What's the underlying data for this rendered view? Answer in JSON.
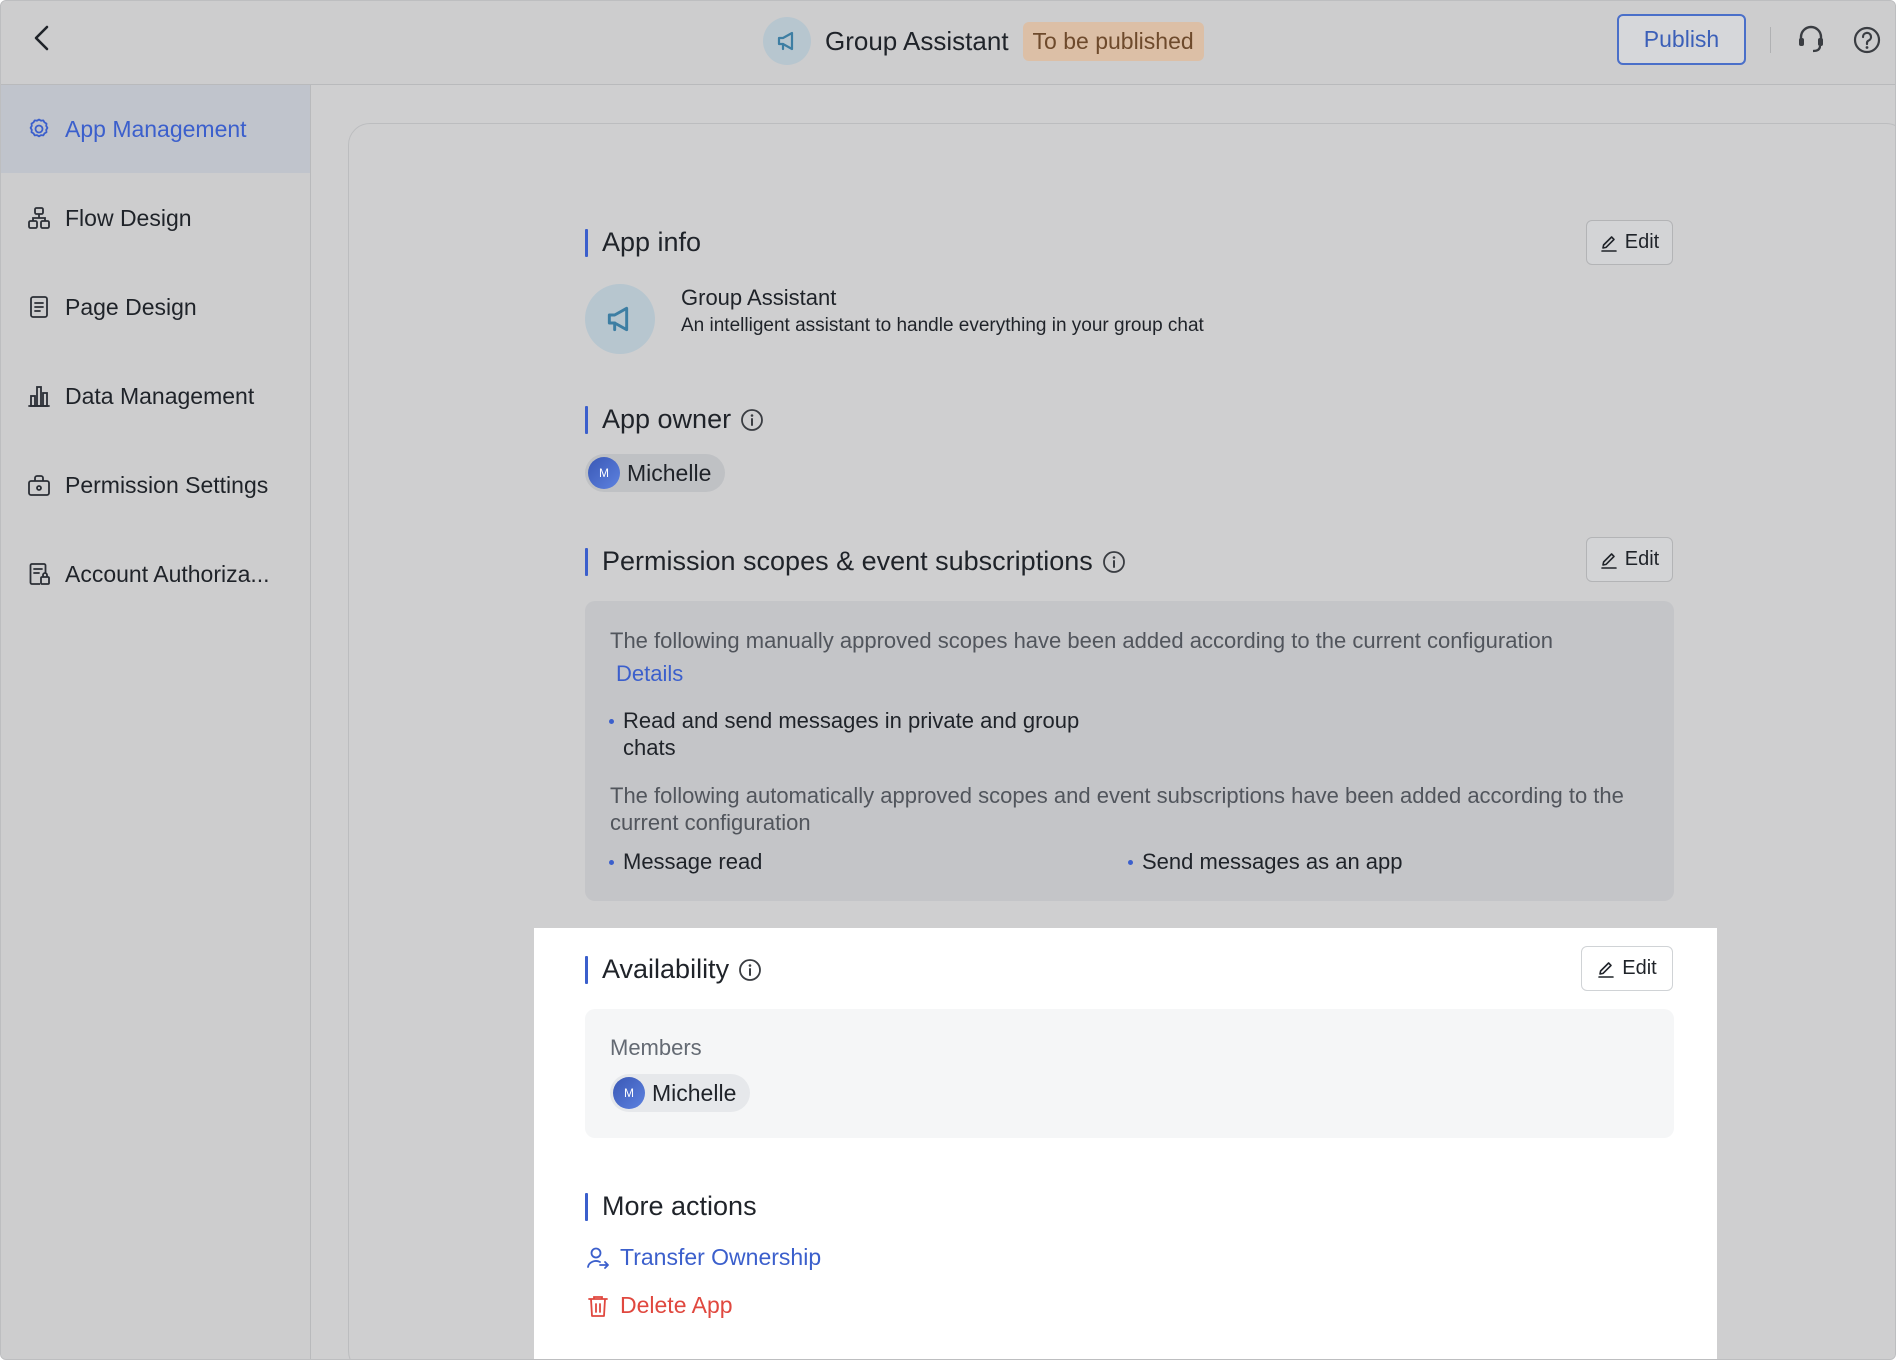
{
  "header": {
    "app_title": "Group Assistant",
    "status": "To be published",
    "publish_label": "Publish"
  },
  "sidebar": {
    "items": [
      {
        "label": "App Management",
        "icon": "gear-icon",
        "active": true
      },
      {
        "label": "Flow Design",
        "icon": "flow-icon",
        "active": false
      },
      {
        "label": "Page Design",
        "icon": "page-icon",
        "active": false
      },
      {
        "label": "Data Management",
        "icon": "bar-chart-icon",
        "active": false
      },
      {
        "label": "Permission Settings",
        "icon": "lock-briefcase-icon",
        "active": false
      },
      {
        "label": "Account Authoriza...",
        "icon": "account-auth-icon",
        "active": false
      }
    ]
  },
  "app_info": {
    "title": "App info",
    "edit_label": "Edit",
    "name": "Group Assistant",
    "description": "An intelligent assistant to handle everything in your group chat"
  },
  "app_owner": {
    "title": "App owner",
    "owner_name": "Michelle",
    "owner_initial": "M"
  },
  "permissions": {
    "title": "Permission scopes & event subscriptions",
    "edit_label": "Edit",
    "manual_text": "The following manually approved scopes have been added according to the current configuration",
    "details_link": "Details",
    "manual_scopes": [
      "Read and send messages in private and group chats"
    ],
    "auto_text": "The following automatically approved scopes and event subscriptions have been added according to the current configuration",
    "auto_scopes": [
      "Message read",
      "Send messages as an app"
    ]
  },
  "availability": {
    "title": "Availability",
    "edit_label": "Edit",
    "members_label": "Members",
    "member_name": "Michelle",
    "member_initial": "M"
  },
  "more_actions": {
    "title": "More actions",
    "transfer_label": "Transfer Ownership",
    "delete_label": "Delete App"
  },
  "colors": {
    "accent": "#3b5fcc",
    "danger": "#e0483f",
    "badge_bg": "#dcbfa6"
  }
}
